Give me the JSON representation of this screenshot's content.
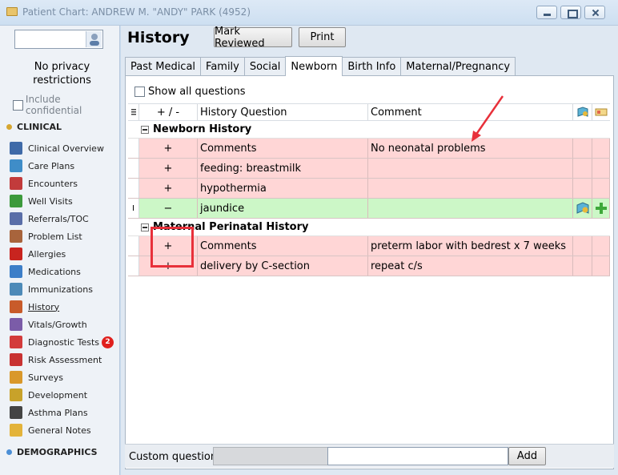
{
  "window": {
    "title": "Patient Chart: ANDREW M. \"ANDY\" PARK (4952)"
  },
  "sidebar": {
    "privacy_text": "No privacy restrictions",
    "include_confidential": "Include confidential",
    "clinical_header": "CLINICAL",
    "demographics_header": "DEMOGRAPHICS",
    "items": [
      {
        "label": "Clinical Overview",
        "icon": "clinical-overview-icon"
      },
      {
        "label": "Care Plans",
        "icon": "care-plans-icon"
      },
      {
        "label": "Encounters",
        "icon": "encounters-icon"
      },
      {
        "label": "Well Visits",
        "icon": "well-visits-icon"
      },
      {
        "label": "Referrals/TOC",
        "icon": "referrals-icon"
      },
      {
        "label": "Problem List",
        "icon": "problem-list-icon"
      },
      {
        "label": "Allergies",
        "icon": "allergies-icon"
      },
      {
        "label": "Medications",
        "icon": "medications-icon"
      },
      {
        "label": "Immunizations",
        "icon": "immunizations-icon"
      },
      {
        "label": "History",
        "icon": "history-icon"
      },
      {
        "label": "Vitals/Growth",
        "icon": "vitals-icon"
      },
      {
        "label": "Diagnostic Tests",
        "icon": "diagnostic-tests-icon",
        "badge": "2"
      },
      {
        "label": "Risk Assessment",
        "icon": "risk-assessment-icon"
      },
      {
        "label": "Surveys",
        "icon": "surveys-icon"
      },
      {
        "label": "Development",
        "icon": "development-icon"
      },
      {
        "label": "Asthma Plans",
        "icon": "asthma-plans-icon"
      },
      {
        "label": "General Notes",
        "icon": "general-notes-icon"
      }
    ]
  },
  "main": {
    "title": "History",
    "mark_reviewed": "Mark Reviewed",
    "print": "Print",
    "tabs": [
      "Past Medical",
      "Family",
      "Social",
      "Newborn",
      "Birth Info",
      "Maternal/Pregnancy"
    ],
    "active_tab": "Newborn",
    "show_all_questions": "Show all questions",
    "grid": {
      "col_plusminus": "+ / -",
      "col_question": "History Question",
      "col_comment": "Comment",
      "groups": [
        {
          "title": "Newborn History",
          "rows": [
            {
              "sign": "+",
              "question": "Comments",
              "comment": "No neonatal problems",
              "state": "red"
            },
            {
              "sign": "+",
              "question": "feeding: breastmilk",
              "comment": "",
              "state": "red"
            },
            {
              "sign": "+",
              "question": "hypothermia",
              "comment": "",
              "state": "red"
            },
            {
              "sign": "−",
              "question": "jaundice",
              "comment": "",
              "state": "green"
            }
          ]
        },
        {
          "title": "Maternal Perinatal History",
          "rows": [
            {
              "sign": "+",
              "question": "Comments",
              "comment": "preterm labor with bedrest x 7 weeks",
              "state": "red"
            },
            {
              "sign": "+",
              "question": "delivery by C-section",
              "comment": "repeat c/s",
              "state": "red"
            }
          ]
        }
      ]
    },
    "custom_question_label": "Custom question:",
    "custom_question_value": "",
    "add_label": "Add"
  },
  "colors": {
    "row_red": "#ffd6d6",
    "row_green": "#ccf7c7",
    "annotation": "#e8303a",
    "badge": "#e0201d"
  }
}
